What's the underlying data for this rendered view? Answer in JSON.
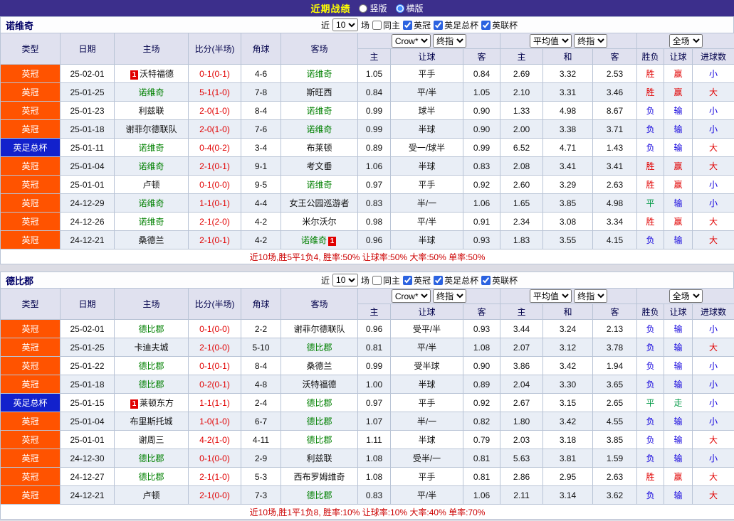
{
  "topbar": {
    "title": "近期战绩",
    "radio_vertical": "竖版",
    "radio_horizontal": "横版"
  },
  "controls": {
    "near_label": "近",
    "matches_value": "10",
    "matches_suffix": "场",
    "same_home": "同主",
    "league1": "英冠",
    "league2": "英足总杯",
    "league3": "英联杯"
  },
  "table_header": {
    "col_type": "类型",
    "col_date": "日期",
    "col_home": "主场",
    "col_score": "比分(半场)",
    "col_corner": "角球",
    "col_away": "客场",
    "dropdown_crow": "Crow*",
    "dropdown_final1": "终指",
    "dropdown_avg": "平均值",
    "dropdown_final2": "终指",
    "dropdown_fulltime": "全场",
    "sub_home": "主",
    "sub_handicap": "让球",
    "sub_away": "客",
    "sub_home2": "主",
    "sub_draw": "和",
    "sub_away2": "客",
    "col_result": "胜负",
    "col_handicap_result": "让球",
    "col_goals": "进球数"
  },
  "colors": {
    "topbar_bg": "#3c2f8c",
    "title": "#ffff00",
    "header_bg": "#e0e1ef",
    "alt_row_bg": "#e9eef6",
    "focus_team": "#008000",
    "score": "#e10000",
    "summary": "#cc0000",
    "league": {
      "英冠": "#ff5300",
      "英足总杯": "#1221cc"
    },
    "outcome": {
      "胜": "#e10000",
      "赢": "#e10000",
      "大": "#e10000",
      "负": "#1100dd",
      "输": "#1100dd",
      "小": "#1100dd",
      "平": "#009944",
      "走": "#009944"
    }
  },
  "sections": [
    {
      "team": "诺维奇",
      "rows": [
        {
          "type": "英冠",
          "date": "25-02-01",
          "home": "沃特福德",
          "home_badge": "1",
          "score": "0-1(0-1)",
          "corner": "4-6",
          "away": "诺维奇",
          "odds_home": "1.05",
          "odds_handicap": "平手",
          "odds_away": "0.84",
          "avg_home": "2.69",
          "avg_draw": "3.32",
          "avg_away": "2.53",
          "result": "胜",
          "handicap": "赢",
          "goals": "小"
        },
        {
          "type": "英冠",
          "date": "25-01-25",
          "home": "诺维奇",
          "score": "5-1(1-0)",
          "corner": "7-8",
          "away": "斯旺西",
          "odds_home": "0.84",
          "odds_handicap": "平/半",
          "odds_away": "1.05",
          "avg_home": "2.10",
          "avg_draw": "3.31",
          "avg_away": "3.46",
          "result": "胜",
          "handicap": "赢",
          "goals": "大"
        },
        {
          "type": "英冠",
          "date": "25-01-23",
          "home": "利兹联",
          "score": "2-0(1-0)",
          "corner": "8-4",
          "away": "诺维奇",
          "odds_home": "0.99",
          "odds_handicap": "球半",
          "odds_away": "0.90",
          "avg_home": "1.33",
          "avg_draw": "4.98",
          "avg_away": "8.67",
          "result": "负",
          "handicap": "输",
          "goals": "小"
        },
        {
          "type": "英冠",
          "date": "25-01-18",
          "home": "谢菲尔德联队",
          "score": "2-0(1-0)",
          "corner": "7-6",
          "away": "诺维奇",
          "odds_home": "0.99",
          "odds_handicap": "半球",
          "odds_away": "0.90",
          "avg_home": "2.00",
          "avg_draw": "3.38",
          "avg_away": "3.71",
          "result": "负",
          "handicap": "输",
          "goals": "小"
        },
        {
          "type": "英足总杯",
          "date": "25-01-11",
          "home": "诺维奇",
          "score": "0-4(0-2)",
          "corner": "3-4",
          "away": "布莱顿",
          "odds_home": "0.89",
          "odds_handicap": "受一/球半",
          "odds_away": "0.99",
          "avg_home": "6.52",
          "avg_draw": "4.71",
          "avg_away": "1.43",
          "result": "负",
          "handicap": "输",
          "goals": "大"
        },
        {
          "type": "英冠",
          "date": "25-01-04",
          "home": "诺维奇",
          "score": "2-1(0-1)",
          "corner": "9-1",
          "away": "考文垂",
          "odds_home": "1.06",
          "odds_handicap": "半球",
          "odds_away": "0.83",
          "avg_home": "2.08",
          "avg_draw": "3.41",
          "avg_away": "3.41",
          "result": "胜",
          "handicap": "赢",
          "goals": "大"
        },
        {
          "type": "英冠",
          "date": "25-01-01",
          "home": "卢顿",
          "score": "0-1(0-0)",
          "corner": "9-5",
          "away": "诺维奇",
          "odds_home": "0.97",
          "odds_handicap": "平手",
          "odds_away": "0.92",
          "avg_home": "2.60",
          "avg_draw": "3.29",
          "avg_away": "2.63",
          "result": "胜",
          "handicap": "赢",
          "goals": "小"
        },
        {
          "type": "英冠",
          "date": "24-12-29",
          "home": "诺维奇",
          "score": "1-1(0-1)",
          "corner": "4-4",
          "away": "女王公园巡游者",
          "odds_home": "0.83",
          "odds_handicap": "半/一",
          "odds_away": "1.06",
          "avg_home": "1.65",
          "avg_draw": "3.85",
          "avg_away": "4.98",
          "result": "平",
          "handicap": "输",
          "goals": "小"
        },
        {
          "type": "英冠",
          "date": "24-12-26",
          "home": "诺维奇",
          "score": "2-1(2-0)",
          "corner": "4-2",
          "away": "米尔沃尔",
          "odds_home": "0.98",
          "odds_handicap": "平/半",
          "odds_away": "0.91",
          "avg_home": "2.34",
          "avg_draw": "3.08",
          "avg_away": "3.34",
          "result": "胜",
          "handicap": "赢",
          "goals": "大"
        },
        {
          "type": "英冠",
          "date": "24-12-21",
          "home": "桑德兰",
          "score": "2-1(0-1)",
          "corner": "4-2",
          "away": "诺维奇",
          "away_badge": "1",
          "odds_home": "0.96",
          "odds_handicap": "半球",
          "odds_away": "0.93",
          "avg_home": "1.83",
          "avg_draw": "3.55",
          "avg_away": "4.15",
          "result": "负",
          "handicap": "输",
          "goals": "大"
        }
      ],
      "summary": "近10场,胜5平1负4, 胜率:50% 让球率:50% 大率:50% 单率:50%"
    },
    {
      "team": "德比郡",
      "rows": [
        {
          "type": "英冠",
          "date": "25-02-01",
          "home": "德比郡",
          "score": "0-1(0-0)",
          "corner": "2-2",
          "away": "谢菲尔德联队",
          "odds_home": "0.96",
          "odds_handicap": "受平/半",
          "odds_away": "0.93",
          "avg_home": "3.44",
          "avg_draw": "3.24",
          "avg_away": "2.13",
          "result": "负",
          "handicap": "输",
          "goals": "小"
        },
        {
          "type": "英冠",
          "date": "25-01-25",
          "home": "卡迪夫城",
          "score": "2-1(0-0)",
          "corner": "5-10",
          "away": "德比郡",
          "odds_home": "0.81",
          "odds_handicap": "平/半",
          "odds_away": "1.08",
          "avg_home": "2.07",
          "avg_draw": "3.12",
          "avg_away": "3.78",
          "result": "负",
          "handicap": "输",
          "goals": "大"
        },
        {
          "type": "英冠",
          "date": "25-01-22",
          "home": "德比郡",
          "score": "0-1(0-1)",
          "corner": "8-4",
          "away": "桑德兰",
          "odds_home": "0.99",
          "odds_handicap": "受半球",
          "odds_away": "0.90",
          "avg_home": "3.86",
          "avg_draw": "3.42",
          "avg_away": "1.94",
          "result": "负",
          "handicap": "输",
          "goals": "小"
        },
        {
          "type": "英冠",
          "date": "25-01-18",
          "home": "德比郡",
          "score": "0-2(0-1)",
          "corner": "4-8",
          "away": "沃特福德",
          "odds_home": "1.00",
          "odds_handicap": "半球",
          "odds_away": "0.89",
          "avg_home": "2.04",
          "avg_draw": "3.30",
          "avg_away": "3.65",
          "result": "负",
          "handicap": "输",
          "goals": "小"
        },
        {
          "type": "英足总杯",
          "date": "25-01-15",
          "home": "莱顿东方",
          "home_badge": "1",
          "score": "1-1(1-1)",
          "corner": "2-4",
          "away": "德比郡",
          "odds_home": "0.97",
          "odds_handicap": "平手",
          "odds_away": "0.92",
          "avg_home": "2.67",
          "avg_draw": "3.15",
          "avg_away": "2.65",
          "result": "平",
          "handicap": "走",
          "goals": "小"
        },
        {
          "type": "英冠",
          "date": "25-01-04",
          "home": "布里斯托城",
          "score": "1-0(1-0)",
          "corner": "6-7",
          "away": "德比郡",
          "odds_home": "1.07",
          "odds_handicap": "半/一",
          "odds_away": "0.82",
          "avg_home": "1.80",
          "avg_draw": "3.42",
          "avg_away": "4.55",
          "result": "负",
          "handicap": "输",
          "goals": "小"
        },
        {
          "type": "英冠",
          "date": "25-01-01",
          "home": "谢周三",
          "score": "4-2(1-0)",
          "corner": "4-11",
          "away": "德比郡",
          "odds_home": "1.11",
          "odds_handicap": "半球",
          "odds_away": "0.79",
          "avg_home": "2.03",
          "avg_draw": "3.18",
          "avg_away": "3.85",
          "result": "负",
          "handicap": "输",
          "goals": "大"
        },
        {
          "type": "英冠",
          "date": "24-12-30",
          "home": "德比郡",
          "score": "0-1(0-0)",
          "corner": "2-9",
          "away": "利兹联",
          "odds_home": "1.08",
          "odds_handicap": "受半/一",
          "odds_away": "0.81",
          "avg_home": "5.63",
          "avg_draw": "3.81",
          "avg_away": "1.59",
          "result": "负",
          "handicap": "输",
          "goals": "小"
        },
        {
          "type": "英冠",
          "date": "24-12-27",
          "home": "德比郡",
          "score": "2-1(1-0)",
          "corner": "5-3",
          "away": "西布罗姆维奇",
          "odds_home": "1.08",
          "odds_handicap": "平手",
          "odds_away": "0.81",
          "avg_home": "2.86",
          "avg_draw": "2.95",
          "avg_away": "2.63",
          "result": "胜",
          "handicap": "赢",
          "goals": "大"
        },
        {
          "type": "英冠",
          "date": "24-12-21",
          "home": "卢顿",
          "score": "2-1(0-0)",
          "corner": "7-3",
          "away": "德比郡",
          "odds_home": "0.83",
          "odds_handicap": "平/半",
          "odds_away": "1.06",
          "avg_home": "2.11",
          "avg_draw": "3.14",
          "avg_away": "3.62",
          "result": "负",
          "handicap": "输",
          "goals": "大"
        }
      ],
      "summary": "近10场,胜1平1负8, 胜率:10% 让球率:10% 大率:40% 单率:70%"
    }
  ]
}
